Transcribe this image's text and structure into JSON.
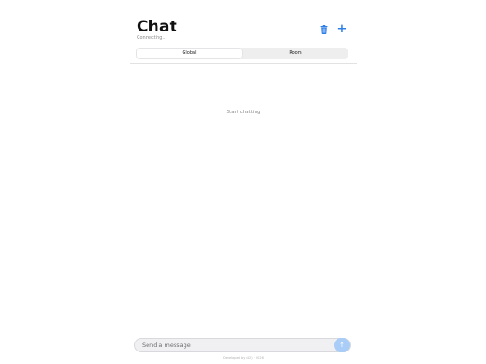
{
  "header": {
    "title": "Chat",
    "status": "Connecting..."
  },
  "toolbar": {
    "trash_icon": "trash-icon",
    "add_icon": "plus-icon",
    "add_label": "+"
  },
  "tabs": [
    {
      "label": "Global",
      "active": true
    },
    {
      "label": "Room",
      "active": false
    }
  ],
  "messages": {
    "empty_text": "Start chatting"
  },
  "composer": {
    "placeholder": "Send a message",
    "value": "",
    "send_icon": "arrow-up-icon",
    "send_label": "↑"
  },
  "footer": {
    "text": "Developed by (42) · 2026"
  },
  "colors": {
    "accent": "#2f7fe8",
    "send_disabled": "#a9cdf6"
  }
}
